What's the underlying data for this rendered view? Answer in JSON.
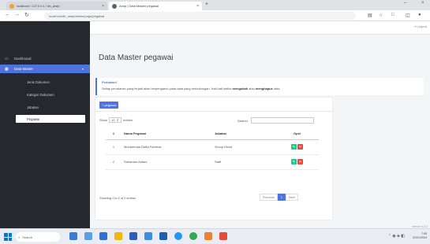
{
  "browser": {
    "tabs": [
      {
        "label": "localhost / 127.0.0.1 / db_arsip",
        "favicon": "phpmyadmin-icon",
        "color": "#f0a030"
      },
      {
        "label": "Arsip | Data Master pegawai",
        "favicon": "globe-icon",
        "color": "#5f6368"
      }
    ],
    "url": "localhost/db_arsip/admin/page/pegawai"
  },
  "topbar": {
    "logout_label": "Logout"
  },
  "sidebar": {
    "items": [
      {
        "label": "Dashboard",
        "icon": "monitor-icon"
      },
      {
        "label": "Data Master",
        "icon": "table-icon"
      }
    ],
    "subitems": [
      "Jenis Dokumen",
      "Kategori Dokumen",
      "Jabatan",
      "Pegawai"
    ]
  },
  "page": {
    "title": "Data Master pegawai",
    "alert": {
      "title": "Perhatian!",
      "text_before": "Setiap perubahan yang terjadi akan berpengaruh pada data yang berhubungan. Hati-hati ketika ",
      "bold1": "mengubah",
      "text_mid": " atau ",
      "bold2": "menghapus",
      "text_after": " data."
    }
  },
  "card": {
    "add_button": "+ pegawai",
    "show_label": "Show",
    "length_value": "10",
    "entries_label": "entries",
    "search_label": "Search:",
    "search_value": "",
    "columns": [
      "#",
      "Nama Pegawai",
      "Jabatan",
      "Opsi"
    ],
    "rows": [
      {
        "no": "1",
        "nama": "Muhammad Daffa Fahreza",
        "jabatan": "Group Head"
      },
      {
        "no": "2",
        "nama": "Sarlaman Adtani",
        "jabatan": "Staff"
      }
    ],
    "info": "Showing 1 to 2 of 2 entries",
    "pager": {
      "prev": "Previous",
      "current": "1",
      "next": "Next"
    }
  },
  "footer": {
    "version": "Version 1.0.0"
  },
  "taskbar": {
    "search_placeholder": "Search",
    "time": "7:55",
    "date": "22/01/2024"
  },
  "colors": {
    "primary": "#4e73df",
    "sidebar": "#25292e",
    "edit": "#1cc88a",
    "delete": "#e74a3b"
  }
}
